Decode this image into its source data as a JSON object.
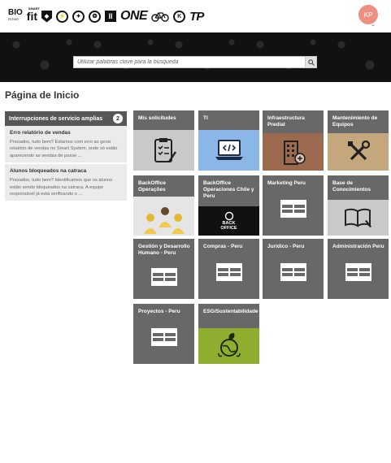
{
  "header": {
    "brands": [
      {
        "name": "bio-ritmo-logo",
        "text": "BIO",
        "sub": "RITMO"
      },
      {
        "name": "smart-fit-logo",
        "text": "fit",
        "sub": "SMART"
      },
      {
        "name": "brand-shield-logo",
        "text": "◆"
      },
      {
        "name": "brand-circle-logo-1",
        "text": "⚡"
      },
      {
        "name": "brand-circle-logo-2",
        "text": "✦"
      },
      {
        "name": "brand-circle-logo-3",
        "text": "❂"
      },
      {
        "name": "brand-box-logo",
        "text": "II"
      },
      {
        "name": "one-logo",
        "text": "ONE"
      },
      {
        "name": "bike-logo",
        "text": ""
      },
      {
        "name": "brand-circle-logo-4",
        "text": "K"
      },
      {
        "name": "tp-logo",
        "text": "TP"
      }
    ],
    "user_initials": "KP",
    "avatar_color": "#ee8f84"
  },
  "search": {
    "placeholder": "Utilizar palabras clave para la búsqueda",
    "icon": "search-icon"
  },
  "page_title": "Página de Inicio",
  "incidents": {
    "title": "Interrupciones de servicio amplias",
    "count": "2",
    "items": [
      {
        "title": "Erro relatório de vendas",
        "body": "Prezados, tudo bem? Estamos com erro ao gerar relatório de vendas no Smart System, onde só estão aparecendo as vendas de passe ..."
      },
      {
        "title": "Alunos bloqueados na catraca",
        "body": "Prezados, tudo bem? Identificamos que os alunos estão sendo bloqueados na catraca. A equipe responsável já está verificando o ..."
      }
    ]
  },
  "tiles": [
    {
      "label": "Mis solicitudes",
      "icon": "clipboard-icon",
      "bg": "#c9c9c9"
    },
    {
      "label": "TI",
      "icon": "laptop-code-icon",
      "bg": "#8ab6e8"
    },
    {
      "label": "Infraestructura Predial",
      "icon": "building-icon",
      "bg": "#9b6a4f"
    },
    {
      "label": "Mantenimiento de Equipos",
      "icon": "tools-icon",
      "bg": "#c4a77c"
    },
    {
      "label": "BackOffice Operações",
      "icon": "people-icon",
      "bg": "#e5e5e5"
    },
    {
      "label": "BackOffice Operaciones Chile y Peru",
      "icon": "backoffice-icon",
      "bg": "#111111",
      "badge": "BACK OFFICE"
    },
    {
      "label": "Marketing Peru",
      "icon": "table-icon"
    },
    {
      "label": "Base de Conocimientos",
      "icon": "book-icon",
      "bg": "#c9c9c9"
    },
    {
      "label": "Gestión y Desarrollo Humano - Peru",
      "icon": "table-icon"
    },
    {
      "label": "Compras - Peru",
      "icon": "table-icon"
    },
    {
      "label": "Juridico - Peru",
      "icon": "table-icon"
    },
    {
      "label": "Administración Peru",
      "icon": "table-icon"
    },
    {
      "label": "Proyectos - Peru",
      "icon": "table-icon"
    },
    {
      "label": "ESG/Sustentabilidade",
      "icon": "globe-leaf-icon",
      "bg": "#8fae2f"
    }
  ]
}
